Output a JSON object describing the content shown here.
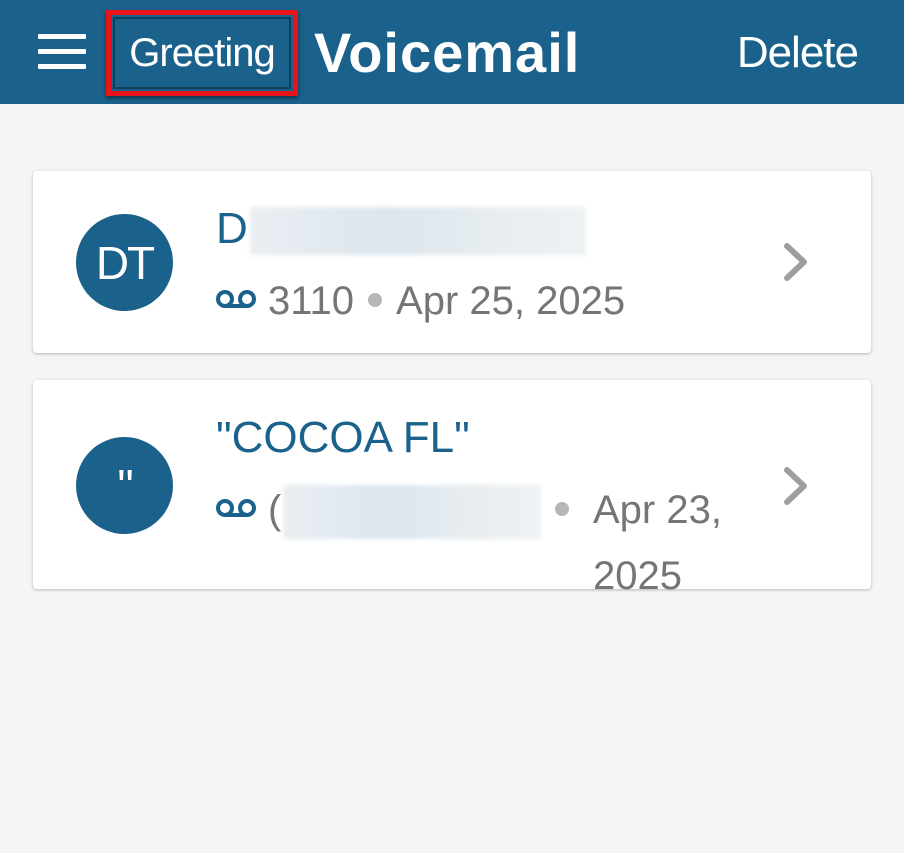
{
  "header": {
    "greeting_label": "Greeting",
    "title": "Voicemail",
    "delete_label": "Delete"
  },
  "voicemails": [
    {
      "initials": "DT",
      "name_visible": "D",
      "number": "3110",
      "date": "Apr 25, 2025",
      "date_line1": "Apr 25, 2025",
      "date_line2": ""
    },
    {
      "initials": "\"",
      "name_visible": "\"COCOA FL\"",
      "number_prefix": "(",
      "date_line1": "Apr 23,",
      "date_line2": "2025"
    }
  ],
  "icons": {
    "menu": "hamburger-menu-icon",
    "voicemail": "voicemail-icon",
    "chevron": "chevron-right-icon"
  },
  "colors": {
    "header_bg": "#1a628b",
    "accent": "#1a628b",
    "highlight_box": "#e8141b",
    "background": "#f5f5f5",
    "secondary_text": "#757575"
  }
}
